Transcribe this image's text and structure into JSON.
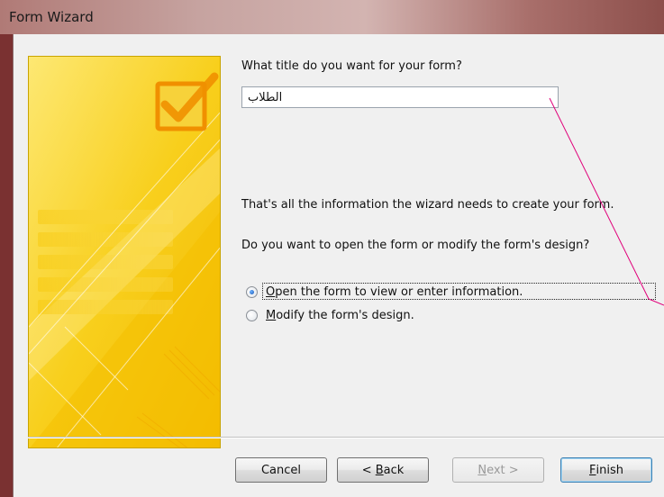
{
  "window": {
    "title": "Form Wizard"
  },
  "prompt_title": "What title do you want for your form?",
  "form_title_value": "الطلاب",
  "info_text": "That's all the information the wizard needs to create your form.",
  "question_text": "Do you want to open the form or modify the form's design?",
  "options": [
    {
      "mnemonic": "O",
      "rest": "pen the form to view or enter information.",
      "selected": true
    },
    {
      "mnemonic": "M",
      "rest": "odify the form's design.",
      "selected": false
    }
  ],
  "buttons": {
    "cancel": {
      "label": "Cancel"
    },
    "back": {
      "prefix": "< ",
      "mnemonic": "B",
      "rest": "ack"
    },
    "next": {
      "mnemonic": "N",
      "rest": "ext >",
      "enabled": false
    },
    "finish": {
      "mnemonic": "F",
      "rest": "inish"
    }
  },
  "colors": {
    "banner_yellow": "#f5c400",
    "banner_light": "#fde26a",
    "annotation_line": "#e0007a"
  }
}
